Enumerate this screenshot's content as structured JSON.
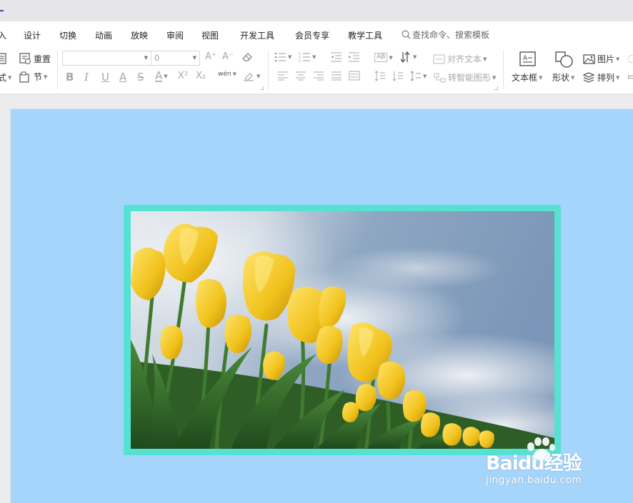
{
  "menu": {
    "items": [
      {
        "label": "入"
      },
      {
        "label": "设计"
      },
      {
        "label": "切换"
      },
      {
        "label": "动画"
      },
      {
        "label": "放映"
      },
      {
        "label": "审阅"
      },
      {
        "label": "视图"
      },
      {
        "label": "开发工具"
      },
      {
        "label": "会员专享"
      },
      {
        "label": "教学工具"
      }
    ],
    "search_label": "查找命令、搜索模板"
  },
  "ribbon": {
    "reset_label": "重置",
    "layout_label": "式",
    "section_label": "节",
    "font_name_value": "",
    "font_size_value": "0",
    "align_text_label": "对齐文本",
    "smartart_label": "转智能图形",
    "textbox_label": "文本框",
    "shape_label": "形状",
    "picture_label": "图片",
    "arrange_label": "排列",
    "bold_glyph": "B",
    "italic_glyph": "I",
    "underline_glyph": "U",
    "strike_glyph": "S",
    "fontcolor_glyph": "A",
    "superscript_glyph": "X²",
    "subscript_glyph": "X₂",
    "phonetic_glyph": "wén",
    "grow_glyph": "A⁺",
    "shrink_glyph": "A⁻",
    "direction_glyph": "AB"
  },
  "slide": {
    "background_color": "#a5d5fb",
    "frame_color": "#57e1d2"
  },
  "watermark": {
    "logo_text": "Baidu经验",
    "url_text": "jingyan.baidu.com"
  }
}
